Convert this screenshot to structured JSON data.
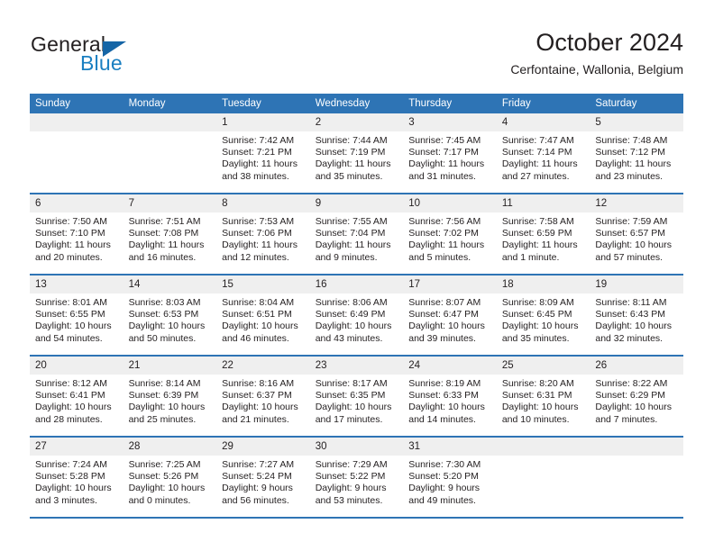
{
  "brand": {
    "name_top": "General",
    "name_bottom": "Blue",
    "triangle_color": "#1565a6",
    "blue_color": "#1a7fc1"
  },
  "header": {
    "month_title": "October 2024",
    "location": "Cerfontaine, Wallonia, Belgium"
  },
  "theme": {
    "header_blue": "#2e74b5",
    "daynum_band": "#efefef",
    "text": "#231f20"
  },
  "weekday_headers": [
    "Sunday",
    "Monday",
    "Tuesday",
    "Wednesday",
    "Thursday",
    "Friday",
    "Saturday"
  ],
  "weeks": [
    [
      {
        "day": "",
        "empty": true,
        "sunrise": "",
        "sunset": "",
        "daylight": ""
      },
      {
        "day": "",
        "empty": true,
        "sunrise": "",
        "sunset": "",
        "daylight": ""
      },
      {
        "day": "1",
        "sunrise": "Sunrise: 7:42 AM",
        "sunset": "Sunset: 7:21 PM",
        "daylight": "Daylight: 11 hours and 38 minutes."
      },
      {
        "day": "2",
        "sunrise": "Sunrise: 7:44 AM",
        "sunset": "Sunset: 7:19 PM",
        "daylight": "Daylight: 11 hours and 35 minutes."
      },
      {
        "day": "3",
        "sunrise": "Sunrise: 7:45 AM",
        "sunset": "Sunset: 7:17 PM",
        "daylight": "Daylight: 11 hours and 31 minutes."
      },
      {
        "day": "4",
        "sunrise": "Sunrise: 7:47 AM",
        "sunset": "Sunset: 7:14 PM",
        "daylight": "Daylight: 11 hours and 27 minutes."
      },
      {
        "day": "5",
        "sunrise": "Sunrise: 7:48 AM",
        "sunset": "Sunset: 7:12 PM",
        "daylight": "Daylight: 11 hours and 23 minutes."
      }
    ],
    [
      {
        "day": "6",
        "sunrise": "Sunrise: 7:50 AM",
        "sunset": "Sunset: 7:10 PM",
        "daylight": "Daylight: 11 hours and 20 minutes."
      },
      {
        "day": "7",
        "sunrise": "Sunrise: 7:51 AM",
        "sunset": "Sunset: 7:08 PM",
        "daylight": "Daylight: 11 hours and 16 minutes."
      },
      {
        "day": "8",
        "sunrise": "Sunrise: 7:53 AM",
        "sunset": "Sunset: 7:06 PM",
        "daylight": "Daylight: 11 hours and 12 minutes."
      },
      {
        "day": "9",
        "sunrise": "Sunrise: 7:55 AM",
        "sunset": "Sunset: 7:04 PM",
        "daylight": "Daylight: 11 hours and 9 minutes."
      },
      {
        "day": "10",
        "sunrise": "Sunrise: 7:56 AM",
        "sunset": "Sunset: 7:02 PM",
        "daylight": "Daylight: 11 hours and 5 minutes."
      },
      {
        "day": "11",
        "sunrise": "Sunrise: 7:58 AM",
        "sunset": "Sunset: 6:59 PM",
        "daylight": "Daylight: 11 hours and 1 minute."
      },
      {
        "day": "12",
        "sunrise": "Sunrise: 7:59 AM",
        "sunset": "Sunset: 6:57 PM",
        "daylight": "Daylight: 10 hours and 57 minutes."
      }
    ],
    [
      {
        "day": "13",
        "sunrise": "Sunrise: 8:01 AM",
        "sunset": "Sunset: 6:55 PM",
        "daylight": "Daylight: 10 hours and 54 minutes."
      },
      {
        "day": "14",
        "sunrise": "Sunrise: 8:03 AM",
        "sunset": "Sunset: 6:53 PM",
        "daylight": "Daylight: 10 hours and 50 minutes."
      },
      {
        "day": "15",
        "sunrise": "Sunrise: 8:04 AM",
        "sunset": "Sunset: 6:51 PM",
        "daylight": "Daylight: 10 hours and 46 minutes."
      },
      {
        "day": "16",
        "sunrise": "Sunrise: 8:06 AM",
        "sunset": "Sunset: 6:49 PM",
        "daylight": "Daylight: 10 hours and 43 minutes."
      },
      {
        "day": "17",
        "sunrise": "Sunrise: 8:07 AM",
        "sunset": "Sunset: 6:47 PM",
        "daylight": "Daylight: 10 hours and 39 minutes."
      },
      {
        "day": "18",
        "sunrise": "Sunrise: 8:09 AM",
        "sunset": "Sunset: 6:45 PM",
        "daylight": "Daylight: 10 hours and 35 minutes."
      },
      {
        "day": "19",
        "sunrise": "Sunrise: 8:11 AM",
        "sunset": "Sunset: 6:43 PM",
        "daylight": "Daylight: 10 hours and 32 minutes."
      }
    ],
    [
      {
        "day": "20",
        "sunrise": "Sunrise: 8:12 AM",
        "sunset": "Sunset: 6:41 PM",
        "daylight": "Daylight: 10 hours and 28 minutes."
      },
      {
        "day": "21",
        "sunrise": "Sunrise: 8:14 AM",
        "sunset": "Sunset: 6:39 PM",
        "daylight": "Daylight: 10 hours and 25 minutes."
      },
      {
        "day": "22",
        "sunrise": "Sunrise: 8:16 AM",
        "sunset": "Sunset: 6:37 PM",
        "daylight": "Daylight: 10 hours and 21 minutes."
      },
      {
        "day": "23",
        "sunrise": "Sunrise: 8:17 AM",
        "sunset": "Sunset: 6:35 PM",
        "daylight": "Daylight: 10 hours and 17 minutes."
      },
      {
        "day": "24",
        "sunrise": "Sunrise: 8:19 AM",
        "sunset": "Sunset: 6:33 PM",
        "daylight": "Daylight: 10 hours and 14 minutes."
      },
      {
        "day": "25",
        "sunrise": "Sunrise: 8:20 AM",
        "sunset": "Sunset: 6:31 PM",
        "daylight": "Daylight: 10 hours and 10 minutes."
      },
      {
        "day": "26",
        "sunrise": "Sunrise: 8:22 AM",
        "sunset": "Sunset: 6:29 PM",
        "daylight": "Daylight: 10 hours and 7 minutes."
      }
    ],
    [
      {
        "day": "27",
        "sunrise": "Sunrise: 7:24 AM",
        "sunset": "Sunset: 5:28 PM",
        "daylight": "Daylight: 10 hours and 3 minutes."
      },
      {
        "day": "28",
        "sunrise": "Sunrise: 7:25 AM",
        "sunset": "Sunset: 5:26 PM",
        "daylight": "Daylight: 10 hours and 0 minutes."
      },
      {
        "day": "29",
        "sunrise": "Sunrise: 7:27 AM",
        "sunset": "Sunset: 5:24 PM",
        "daylight": "Daylight: 9 hours and 56 minutes."
      },
      {
        "day": "30",
        "sunrise": "Sunrise: 7:29 AM",
        "sunset": "Sunset: 5:22 PM",
        "daylight": "Daylight: 9 hours and 53 minutes."
      },
      {
        "day": "31",
        "sunrise": "Sunrise: 7:30 AM",
        "sunset": "Sunset: 5:20 PM",
        "daylight": "Daylight: 9 hours and 49 minutes."
      },
      {
        "day": "",
        "empty": true,
        "sunrise": "",
        "sunset": "",
        "daylight": ""
      },
      {
        "day": "",
        "empty": true,
        "sunrise": "",
        "sunset": "",
        "daylight": ""
      }
    ]
  ]
}
